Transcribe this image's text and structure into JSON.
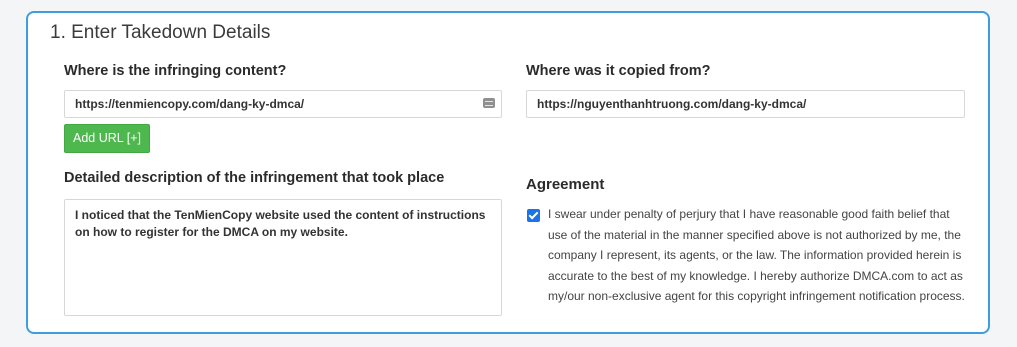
{
  "section": {
    "title": "1. Enter Takedown Details"
  },
  "infringing": {
    "label": "Where is the infringing content?",
    "value": "https://tenmiencopy.com/dang-ky-dmca/",
    "add_button": "Add URL [+]"
  },
  "copied_from": {
    "label": "Where was it copied from?",
    "value": "https://nguyenthanhtruong.com/dang-ky-dmca/"
  },
  "description": {
    "label": "Detailed description of the infringement that took place",
    "value": "I noticed that the TenMienCopy website used the content of instructions on how to register for the DMCA on my website."
  },
  "agreement": {
    "title": "Agreement",
    "checked": true,
    "text": "I swear under penalty of perjury that I have reasonable good faith belief that use of the material in the manner specified above is not authorized by me, the company I represent, its agents, or the law. The information provided herein is accurate to the best of my knowledge. I hereby authorize DMCA.com to act as my/our non-exclusive agent for this copyright infringement notification process."
  },
  "colors": {
    "panel_border": "#3f9ddf",
    "add_button": "#4db84d",
    "checkbox": "#1a73e8"
  }
}
